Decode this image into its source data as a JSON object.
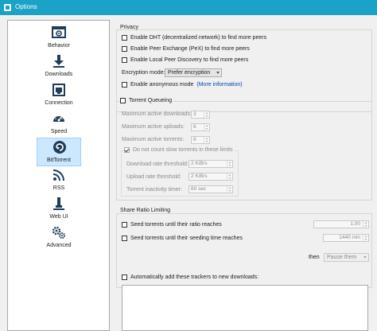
{
  "window": {
    "title": "Options"
  },
  "sidebar": {
    "items": [
      {
        "label": "Behavior",
        "icon": "gear-window-icon"
      },
      {
        "label": "Downloads",
        "icon": "download-arrow-icon"
      },
      {
        "label": "Connection",
        "icon": "network-port-icon"
      },
      {
        "label": "Speed",
        "icon": "speedometer-icon"
      },
      {
        "label": "BitTorrent",
        "icon": "bittorrent-icon",
        "selected": true
      },
      {
        "label": "RSS",
        "icon": "rss-feed-icon"
      },
      {
        "label": "Web UI",
        "icon": "web-ui-icon"
      },
      {
        "label": "Advanced",
        "icon": "advanced-gears-icon"
      }
    ]
  },
  "privacy": {
    "title": "Privacy",
    "dht": "Enable DHT (decentralized network) to find more peers",
    "pex": "Enable Peer Exchange (PeX) to find more peers",
    "lpd": "Enable Local Peer Discovery to find more peers",
    "encryption_label": "Encryption mode:",
    "encryption_value": "Prefer encryption",
    "anonymous": "Enable anonymous mode",
    "more_info": "(More information)"
  },
  "queueing": {
    "title": "Torrent Queueing",
    "max_downloads_label": "Maximum active downloads:",
    "max_downloads": "3",
    "max_uploads_label": "Maximum active uploads:",
    "max_uploads": "6",
    "max_torrents_label": "Maximum active torrents:",
    "max_torrents": "8",
    "slow_label": "Do not count slow torrents in these limits",
    "dl_threshold_label": "Download rate threshold:",
    "dl_threshold": "2 KiB/s",
    "ul_threshold_label": "Upload rate threshold:",
    "ul_threshold": "2 KiB/s",
    "inactivity_label": "Torrent inactivity timer:",
    "inactivity": "60 sec"
  },
  "share_ratio": {
    "title": "Share Ratio Limiting",
    "ratio_label": "Seed torrents until their ratio reaches",
    "ratio_value": "1.00",
    "time_label": "Seed torrents until their seeding time reaches",
    "time_value": "1440 min",
    "then_label": "then",
    "then_value": "Pause them"
  },
  "trackers": {
    "label": "Automatically add these trackers to new downloads:"
  },
  "colors": {
    "titlebar": "#1aa3c6",
    "selection": "#cce8ff",
    "link": "#0645ad"
  }
}
